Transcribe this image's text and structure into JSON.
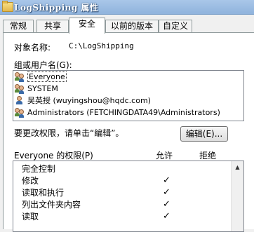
{
  "window": {
    "title": "LogShipping 属性"
  },
  "tabs": [
    {
      "label": "常规"
    },
    {
      "label": "共享"
    },
    {
      "label": "安全"
    },
    {
      "label": "以前的版本"
    },
    {
      "label": "自定义"
    }
  ],
  "object": {
    "label": "对象名称:",
    "value": "C:\\LogShipping"
  },
  "groups": {
    "label": "组或用户名(G):",
    "items": [
      {
        "name": "Everyone"
      },
      {
        "name": "SYSTEM"
      },
      {
        "name": "吴英授 (wuyingshou@hqdc.com)"
      },
      {
        "name": "Administrators (FETCHINGDATA49\\Administrators)"
      }
    ]
  },
  "change_hint": "要更改权限，请单击“编辑”。",
  "edit_button": "编辑(E)...",
  "permissions": {
    "label": "Everyone 的权限(P)",
    "allow_header": "允许",
    "deny_header": "拒绝",
    "items": [
      {
        "name": "完全控制",
        "allow": ""
      },
      {
        "name": "修改",
        "allow": "✓"
      },
      {
        "name": "读取和执行",
        "allow": "✓"
      },
      {
        "name": "列出文件夹内容",
        "allow": "✓"
      },
      {
        "name": "读取",
        "allow": "✓"
      }
    ]
  }
}
